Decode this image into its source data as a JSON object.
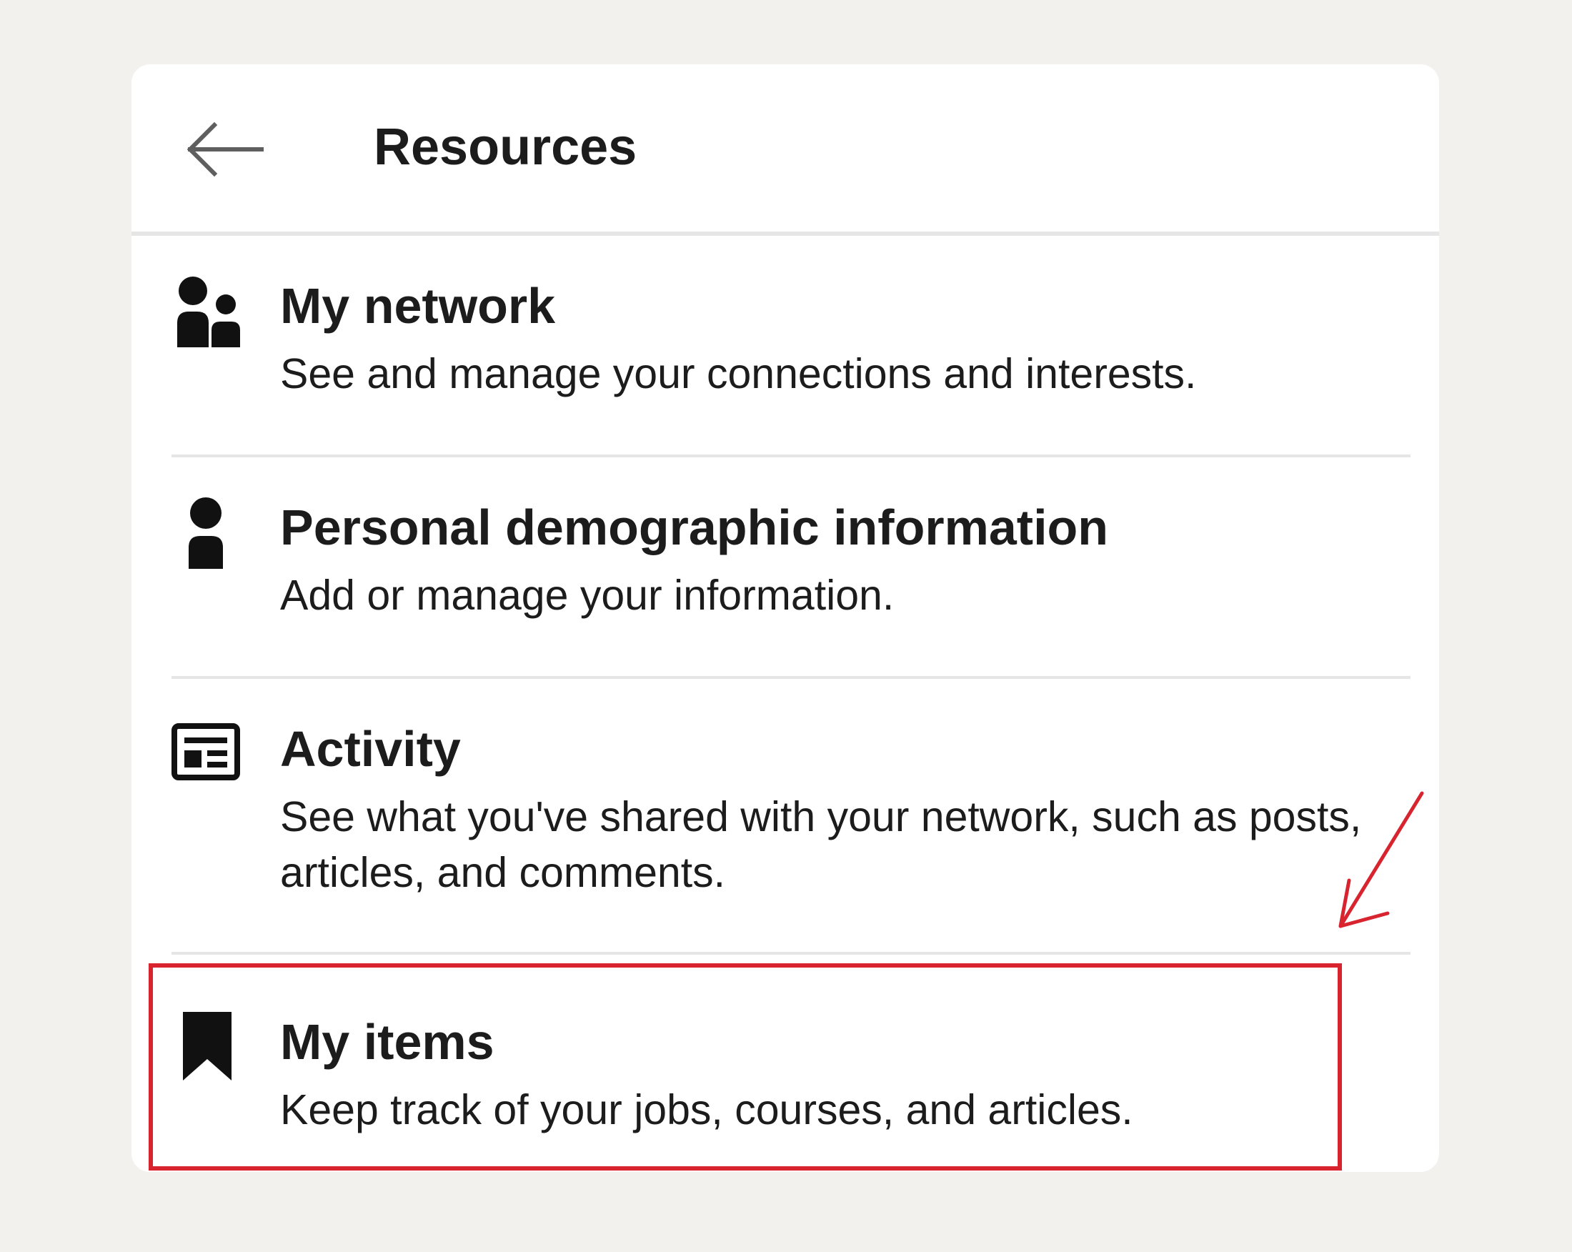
{
  "header": {
    "title": "Resources",
    "back_icon": "arrow-left-icon"
  },
  "items": [
    {
      "title": "My network",
      "description": "See and manage your connections and interests.",
      "icon": "people-icon"
    },
    {
      "title": "Personal demographic information",
      "description": "Add or manage your information.",
      "icon": "person-icon"
    },
    {
      "title": "Activity",
      "description": "See what you've shared with your network, such as posts, articles, and comments.",
      "icon": "activity-feed-icon"
    },
    {
      "title": "My items",
      "description": "Keep track of your jobs, courses, and articles.",
      "icon": "bookmark-icon"
    }
  ],
  "annotation": {
    "highlight_color": "#d8242f",
    "highlighted_item": "My items"
  },
  "colors": {
    "background": "#f3f1ed",
    "card": "#ffffff",
    "text": "#1c1c1c",
    "divider": "#e6e6e6"
  }
}
